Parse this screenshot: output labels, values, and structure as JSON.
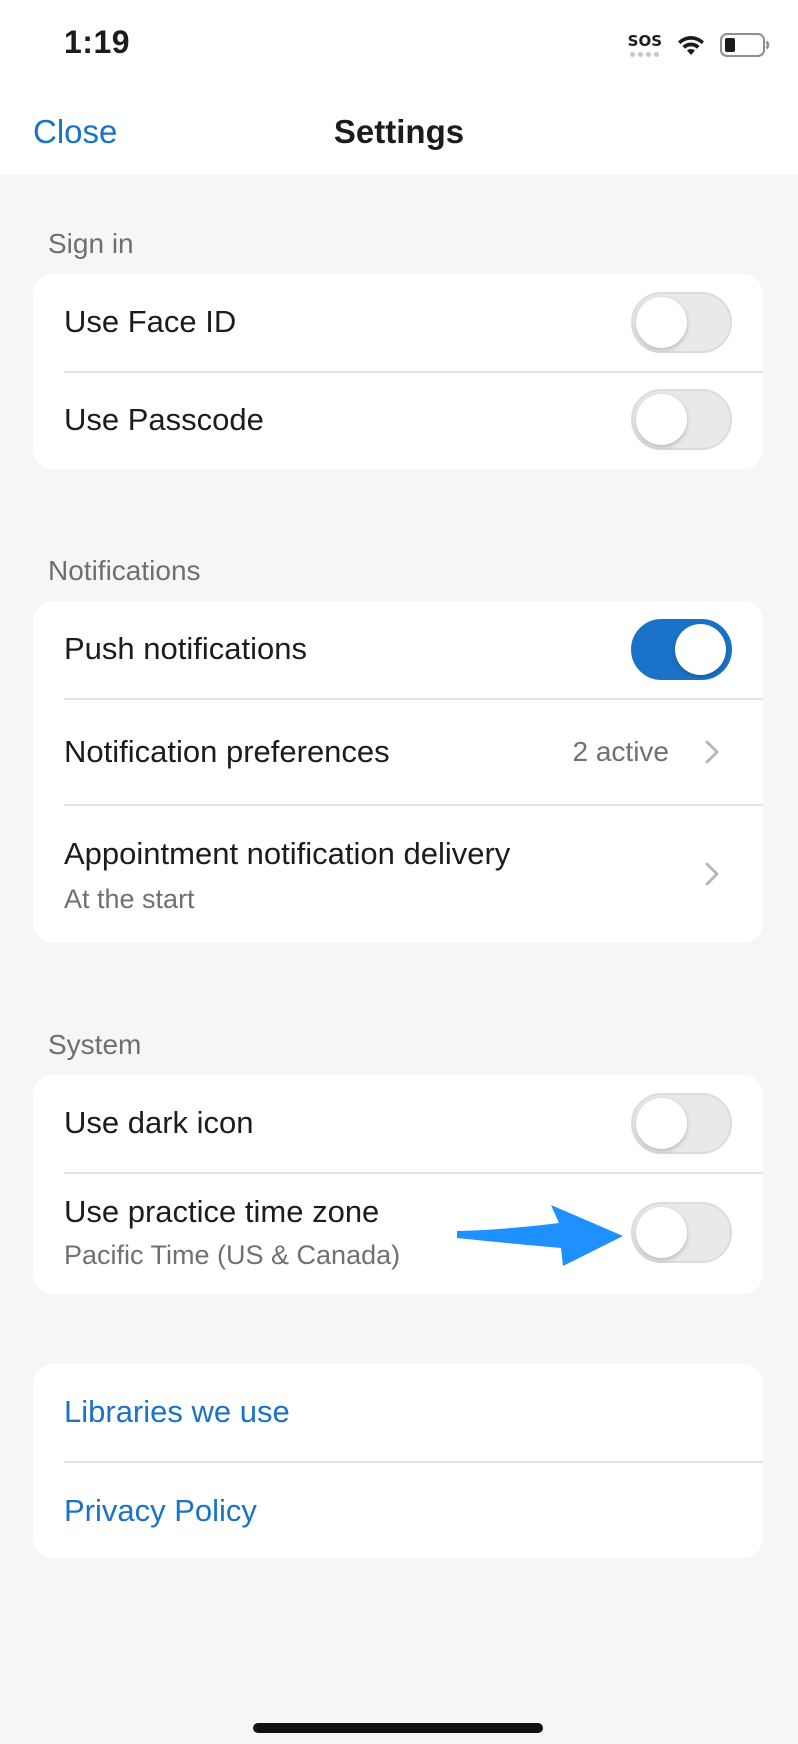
{
  "status_bar": {
    "time": "1:19",
    "sos": "SOS"
  },
  "nav": {
    "close_label": "Close",
    "title": "Settings"
  },
  "sections": {
    "sign_in": {
      "header": "Sign in",
      "face_id": {
        "label": "Use Face ID",
        "enabled": false
      },
      "passcode": {
        "label": "Use Passcode",
        "enabled": false
      }
    },
    "notifications": {
      "header": "Notifications",
      "push": {
        "label": "Push notifications",
        "enabled": true
      },
      "preferences": {
        "label": "Notification preferences",
        "value": "2 active"
      },
      "appointment_delivery": {
        "label": "Appointment notification delivery",
        "value": "At the start"
      }
    },
    "system": {
      "header": "System",
      "dark_icon": {
        "label": "Use dark icon",
        "enabled": false
      },
      "practice_time_zone": {
        "label": "Use practice time zone",
        "value": "Pacific Time (US & Canada)",
        "enabled": false
      }
    },
    "about": {
      "libraries": "Libraries we use",
      "privacy": "Privacy Policy"
    }
  },
  "colors": {
    "accent": "#1a73c8",
    "annotation_arrow": "#1e90ff",
    "background": "#f6f6f6"
  },
  "icons": [
    "wifi-icon",
    "battery-icon",
    "chevron-right-icon",
    "annotation-arrow"
  ]
}
